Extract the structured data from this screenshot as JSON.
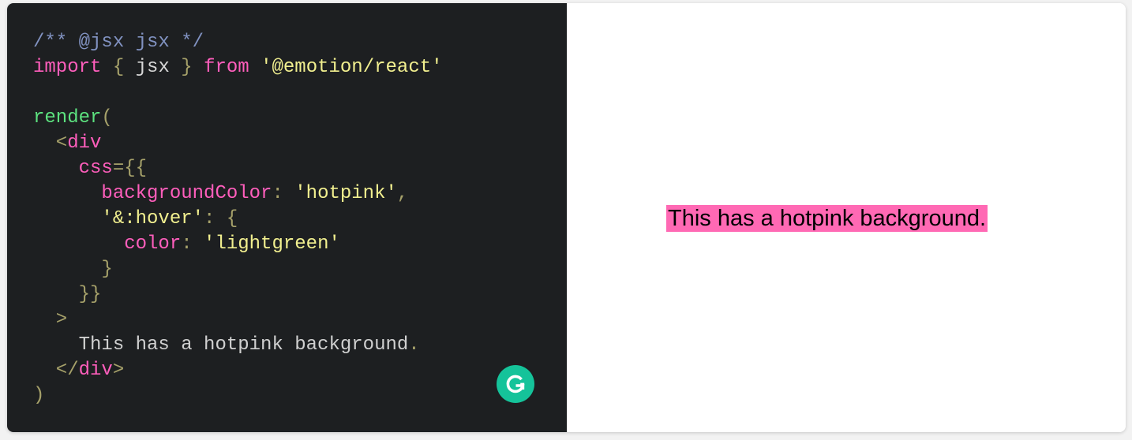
{
  "editor": {
    "lines": [
      [
        {
          "t": "/** @jsx jsx */",
          "c": "comment"
        }
      ],
      [
        {
          "t": "import",
          "c": "keyword"
        },
        {
          "t": " { ",
          "c": "punct"
        },
        {
          "t": "jsx",
          "c": "ident"
        },
        {
          "t": " } ",
          "c": "punct"
        },
        {
          "t": "from",
          "c": "keyword"
        },
        {
          "t": " '@emotion/react'",
          "c": "string"
        }
      ],
      [],
      [
        {
          "t": "render",
          "c": "fn"
        },
        {
          "t": "(",
          "c": "punct"
        }
      ],
      [
        {
          "t": "  <",
          "c": "punct"
        },
        {
          "t": "div",
          "c": "tag"
        }
      ],
      [
        {
          "t": "    css",
          "c": "attr"
        },
        {
          "t": "={{",
          "c": "punct"
        }
      ],
      [
        {
          "t": "      backgroundColor",
          "c": "prop"
        },
        {
          "t": ": ",
          "c": "punct"
        },
        {
          "t": "'hotpink'",
          "c": "string"
        },
        {
          "t": ",",
          "c": "punct"
        }
      ],
      [
        {
          "t": "      '&:hover'",
          "c": "string"
        },
        {
          "t": ": {",
          "c": "punct"
        }
      ],
      [
        {
          "t": "        color",
          "c": "prop"
        },
        {
          "t": ": ",
          "c": "punct"
        },
        {
          "t": "'lightgreen'",
          "c": "string"
        }
      ],
      [
        {
          "t": "      }",
          "c": "punct"
        }
      ],
      [
        {
          "t": "    }}",
          "c": "punct"
        }
      ],
      [
        {
          "t": "  >",
          "c": "punct"
        }
      ],
      [
        {
          "t": "    This has a hotpink background",
          "c": "text"
        },
        {
          "t": ".",
          "c": "punct"
        }
      ],
      [
        {
          "t": "  </",
          "c": "punct"
        },
        {
          "t": "div",
          "c": "tag"
        },
        {
          "t": ">",
          "c": "punct"
        }
      ],
      [
        {
          "t": ")",
          "c": "punct"
        }
      ]
    ],
    "background": "#1d1f21",
    "colors": {
      "comment": "#8192c1",
      "keyword": "#ff5ebc",
      "string": "#f1ef8f",
      "function": "#5ce27f",
      "punctuation": "#a6a16a",
      "text": "#d0d0d0"
    },
    "grammarly_icon": "grammarly-g-icon",
    "grammarly_color": "#15c39a"
  },
  "preview": {
    "output_text": "This has a hotpink background.",
    "background_color": "#ff69b4",
    "hover_color": "#90ee90"
  }
}
